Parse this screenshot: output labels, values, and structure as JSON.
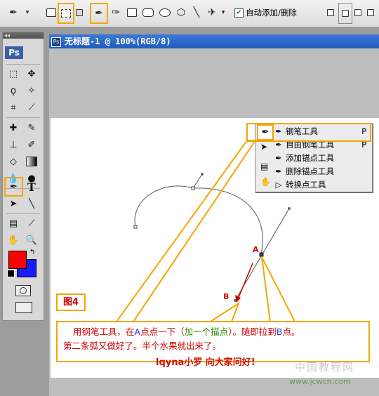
{
  "options_bar": {
    "auto_add_delete_label": "自动添加/删除",
    "auto_add_delete_checked": true
  },
  "toolbox": {
    "logo": "Ps",
    "collapse_glyph": "◂◂"
  },
  "document": {
    "title": "无标题-1 @ 100%(RGB/8)"
  },
  "flyout": {
    "items": [
      {
        "label": "钢笔工具",
        "key": "P",
        "glyph": "✒",
        "selected": true
      },
      {
        "label": "自由钢笔工具",
        "key": "P",
        "glyph": "✒"
      },
      {
        "label": "添加锚点工具",
        "key": "",
        "glyph": "✒"
      },
      {
        "label": "删除锚点工具",
        "key": "",
        "glyph": "✒"
      },
      {
        "label": "转换点工具",
        "key": "",
        "glyph": "▷"
      }
    ]
  },
  "canvas_labels": {
    "point_a": "A",
    "point_b": "B"
  },
  "figure_label": "图4",
  "note": {
    "line1_a": "用钢笔工具，在",
    "line1_b": "A",
    "line1_c": "点点一下（",
    "line1_d": "加一个描点",
    "line1_e": "）。随即拉到",
    "line1_f": "B",
    "line1_g": "点。",
    "line2": "第二条弧又做好了。半个水果就出来了。"
  },
  "greeting": "lqyna小罗 向大家问好!",
  "watermark": "www.jcwcn.com",
  "watermark2": "中国教程网",
  "colors": {
    "accent": "#f5a500",
    "foreground": "#ff0000",
    "background": "#1a1aff",
    "title_bar": "#2f6bcf"
  }
}
